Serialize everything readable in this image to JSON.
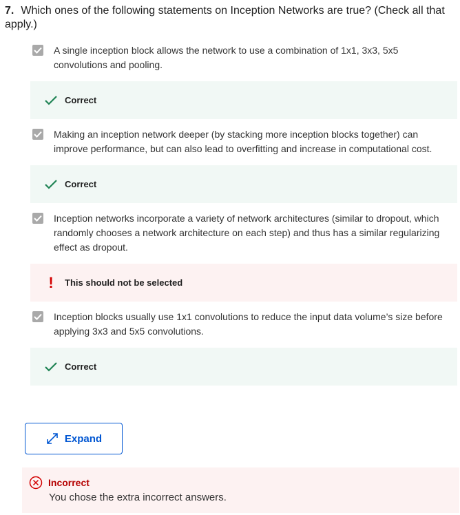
{
  "question": {
    "number": "7.",
    "text": "Which ones of the following statements on Inception Networks are true? (Check all that apply.)"
  },
  "options": [
    {
      "text": "A single inception block allows the network to use a combination of 1x1, 3x3, 5x5 convolutions and pooling.",
      "checked": true,
      "feedback": {
        "status": "correct",
        "label": "Correct"
      }
    },
    {
      "text": "Making an inception network deeper (by stacking more inception blocks together) can improve performance, but can also lead to overfitting and increase in computational cost.",
      "checked": true,
      "feedback": {
        "status": "wrong",
        "label": "Correct"
      }
    },
    {
      "text": "Inception networks incorporate a variety of network architectures (similar to dropout, which randomly chooses a network architecture on each step) and thus has a similar regularizing effect as dropout.",
      "checked": true,
      "feedback": {
        "status": "wrong",
        "label": "This should not be selected"
      }
    },
    {
      "text": "Inception blocks usually use 1x1 convolutions to reduce the input data volume’s size before applying 3x3 and 5x5 convolutions.",
      "checked": true,
      "feedback": {
        "status": "correct",
        "label": "Correct"
      }
    }
  ],
  "expand_button": {
    "label": "Expand"
  },
  "result": {
    "status": "Incorrect",
    "message": "You chose the extra incorrect answers."
  },
  "colors": {
    "correct_green": "#1f8354",
    "error_red": "#d30000",
    "link_blue": "#0056d2",
    "correct_bg": "#f1f8f5",
    "wrong_bg": "#fdf2f2"
  }
}
